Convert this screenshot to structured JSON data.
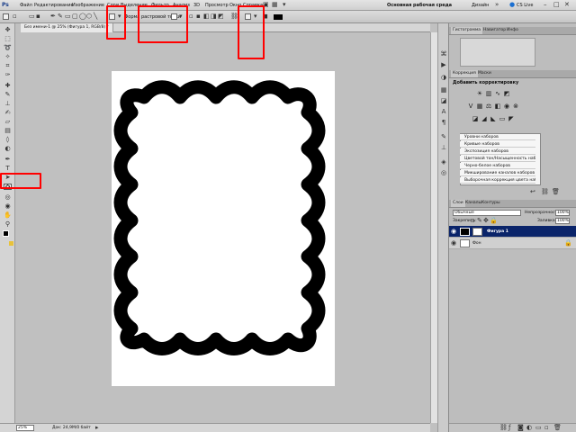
{
  "menubar": {
    "items": [
      "Файл",
      "Редактирование",
      "Изображение",
      "Слои",
      "Выделение",
      "Фильтр",
      "Анализ",
      "3D",
      "Просмотр",
      "Окно",
      "Справка"
    ],
    "workspace_label": "Основная рабочая среда",
    "design_label": "Дизайн",
    "cslive_label": "CS Live"
  },
  "optionsbar": {
    "fill_label": "Форма растровой точки"
  },
  "document": {
    "tab_title": "Без имени-1 @ 25% (Фигура 1, RGB/8) *"
  },
  "statusbar": {
    "zoom": "25%",
    "doc_info": "Док: 24,9М/0 байт"
  },
  "panels": {
    "histogram_tabs": [
      "Гистограмма",
      "Навигатор",
      "Инфо"
    ],
    "adjust_tabs": [
      "Коррекция",
      "Маски"
    ],
    "adjust_title": "Добавить корректировку",
    "presets": [
      "Уровни наборов",
      "Кривые наборов",
      "Экспозиция наборов",
      "Цветовой тон/Насыщенность наборов",
      "Черно-белое наборов",
      "Микширование каналов наборов",
      "Выборочная коррекция цвета наборов"
    ],
    "layer_tabs": [
      "Слои",
      "Каналы",
      "Контуры"
    ],
    "blend_mode": "Обычные",
    "opacity_label": "Непрозрачность:",
    "opacity_value": "100%",
    "lock_label": "Закрепить:",
    "fill_label": "Заливка:",
    "fill_value": "100%",
    "layers": [
      {
        "name": "Фигура 1",
        "selected": true
      },
      {
        "name": "Фон",
        "selected": false
      }
    ]
  },
  "colors": {
    "highlight": "#ff0000",
    "selected_layer": "#0a246a",
    "shape": "#000000"
  }
}
